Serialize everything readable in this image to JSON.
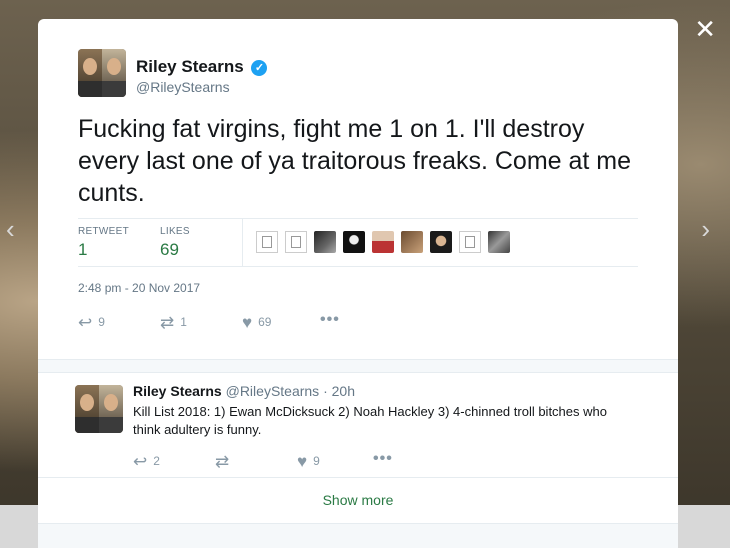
{
  "close_label": "✕",
  "nav": {
    "prev": "‹",
    "next": "›"
  },
  "main_tweet": {
    "name": "Riley Stearns",
    "verified_glyph": "✓",
    "handle": "@RileyStearns",
    "text": "Fucking fat virgins, fight me 1 on 1. I'll destroy every last one of ya traitorous freaks. Come at me cunts.",
    "stats": {
      "retweet_label": "RETWEET",
      "retweet_count": "1",
      "likes_label": "LIKES",
      "likes_count": "69"
    },
    "timestamp": "2:48 pm - 20 Nov 2017",
    "actions": {
      "reply": "9",
      "retweet": "1",
      "like": "69",
      "more": "•••"
    }
  },
  "reply_tweet": {
    "name": "Riley Stearns",
    "handle": "@RileyStearns",
    "time": "· 20h",
    "text": "Kill List 2018: 1) Ewan McDicksuck 2) Noah Hackley 3) 4-chinned troll bitches who think adultery is funny.",
    "actions": {
      "reply": "2",
      "retweet": "",
      "like": "9",
      "more": "•••"
    }
  },
  "show_more": "Show more",
  "icons": {
    "reply": "reply-icon",
    "retweet": "retweet-icon",
    "like": "heart-icon",
    "more": "more-icon"
  },
  "colors": {
    "link_green": "#2a7a44",
    "verified_blue": "#1da1f2",
    "muted": "#657786"
  }
}
